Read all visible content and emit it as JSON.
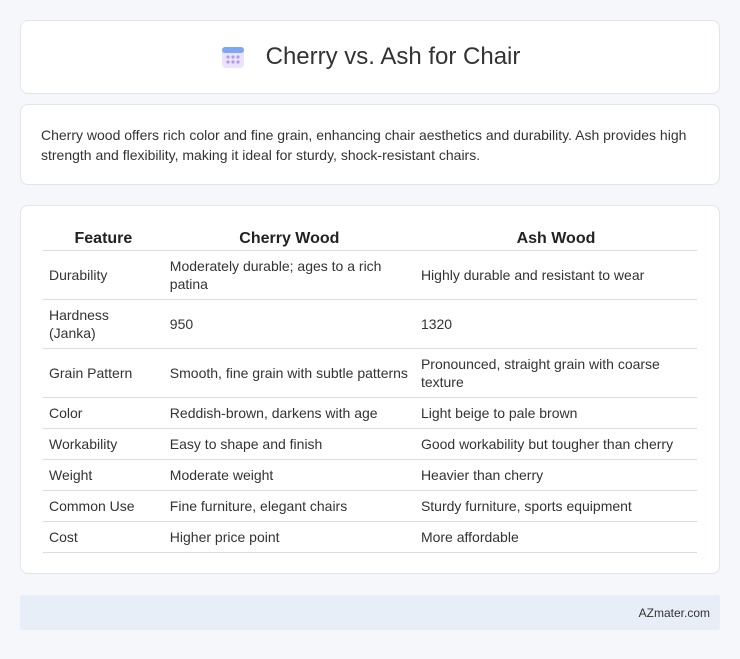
{
  "header": {
    "title": "Cherry vs. Ash for Chair",
    "icon": "calendar-icon"
  },
  "intro": {
    "text": "Cherry wood offers rich color and fine grain, enhancing chair aesthetics and durability. Ash provides high strength and flexibility, making it ideal for sturdy, shock-resistant chairs."
  },
  "table": {
    "headers": [
      "Feature",
      "Cherry Wood",
      "Ash Wood"
    ],
    "rows": [
      [
        "Durability",
        "Moderately durable; ages to a rich patina",
        "Highly durable and resistant to wear"
      ],
      [
        "Hardness (Janka)",
        "950",
        "1320"
      ],
      [
        "Grain Pattern",
        "Smooth, fine grain with subtle patterns",
        "Pronounced, straight grain with coarse texture"
      ],
      [
        "Color",
        "Reddish-brown, darkens with age",
        "Light beige to pale brown"
      ],
      [
        "Workability",
        "Easy to shape and finish",
        "Good workability but tougher than cherry"
      ],
      [
        "Weight",
        "Moderate weight",
        "Heavier than cherry"
      ],
      [
        "Common Use",
        "Fine furniture, elegant chairs",
        "Sturdy furniture, sports equipment"
      ],
      [
        "Cost",
        "Higher price point",
        "More affordable"
      ]
    ]
  },
  "footer": {
    "brand": "AZmater.com"
  }
}
